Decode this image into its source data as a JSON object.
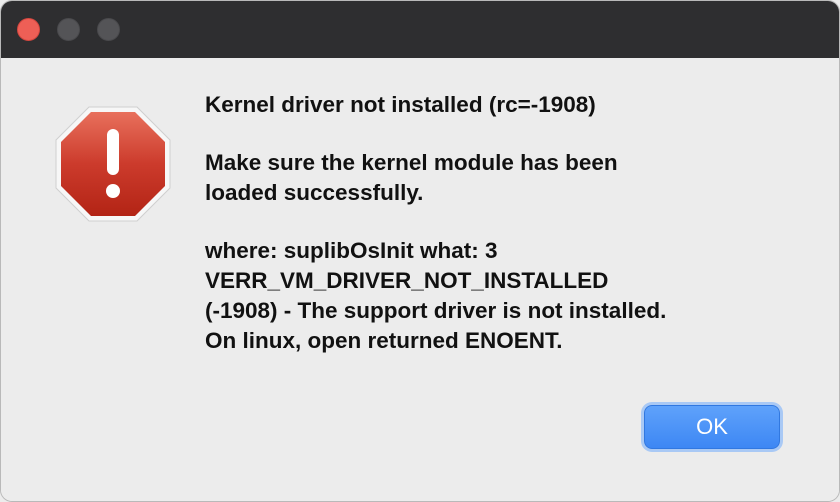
{
  "window": {
    "controls": [
      "close",
      "minimize",
      "zoom"
    ]
  },
  "dialog": {
    "icon": "stop-alert-icon",
    "title": "Kernel driver not installed (rc=-1908)",
    "detail": "Make sure the kernel module has been\nloaded successfully.",
    "error": "where: suplibOsInit what: 3\nVERR_VM_DRIVER_NOT_INSTALLED\n(-1908) - The support driver is not installed.\nOn linux, open returned ENOENT.",
    "ok_label": "OK"
  },
  "colors": {
    "titlebar": "#2e2e30",
    "close": "#ee5f56",
    "button_accent": "#3d87f4",
    "alert_red": "#c0392b"
  }
}
